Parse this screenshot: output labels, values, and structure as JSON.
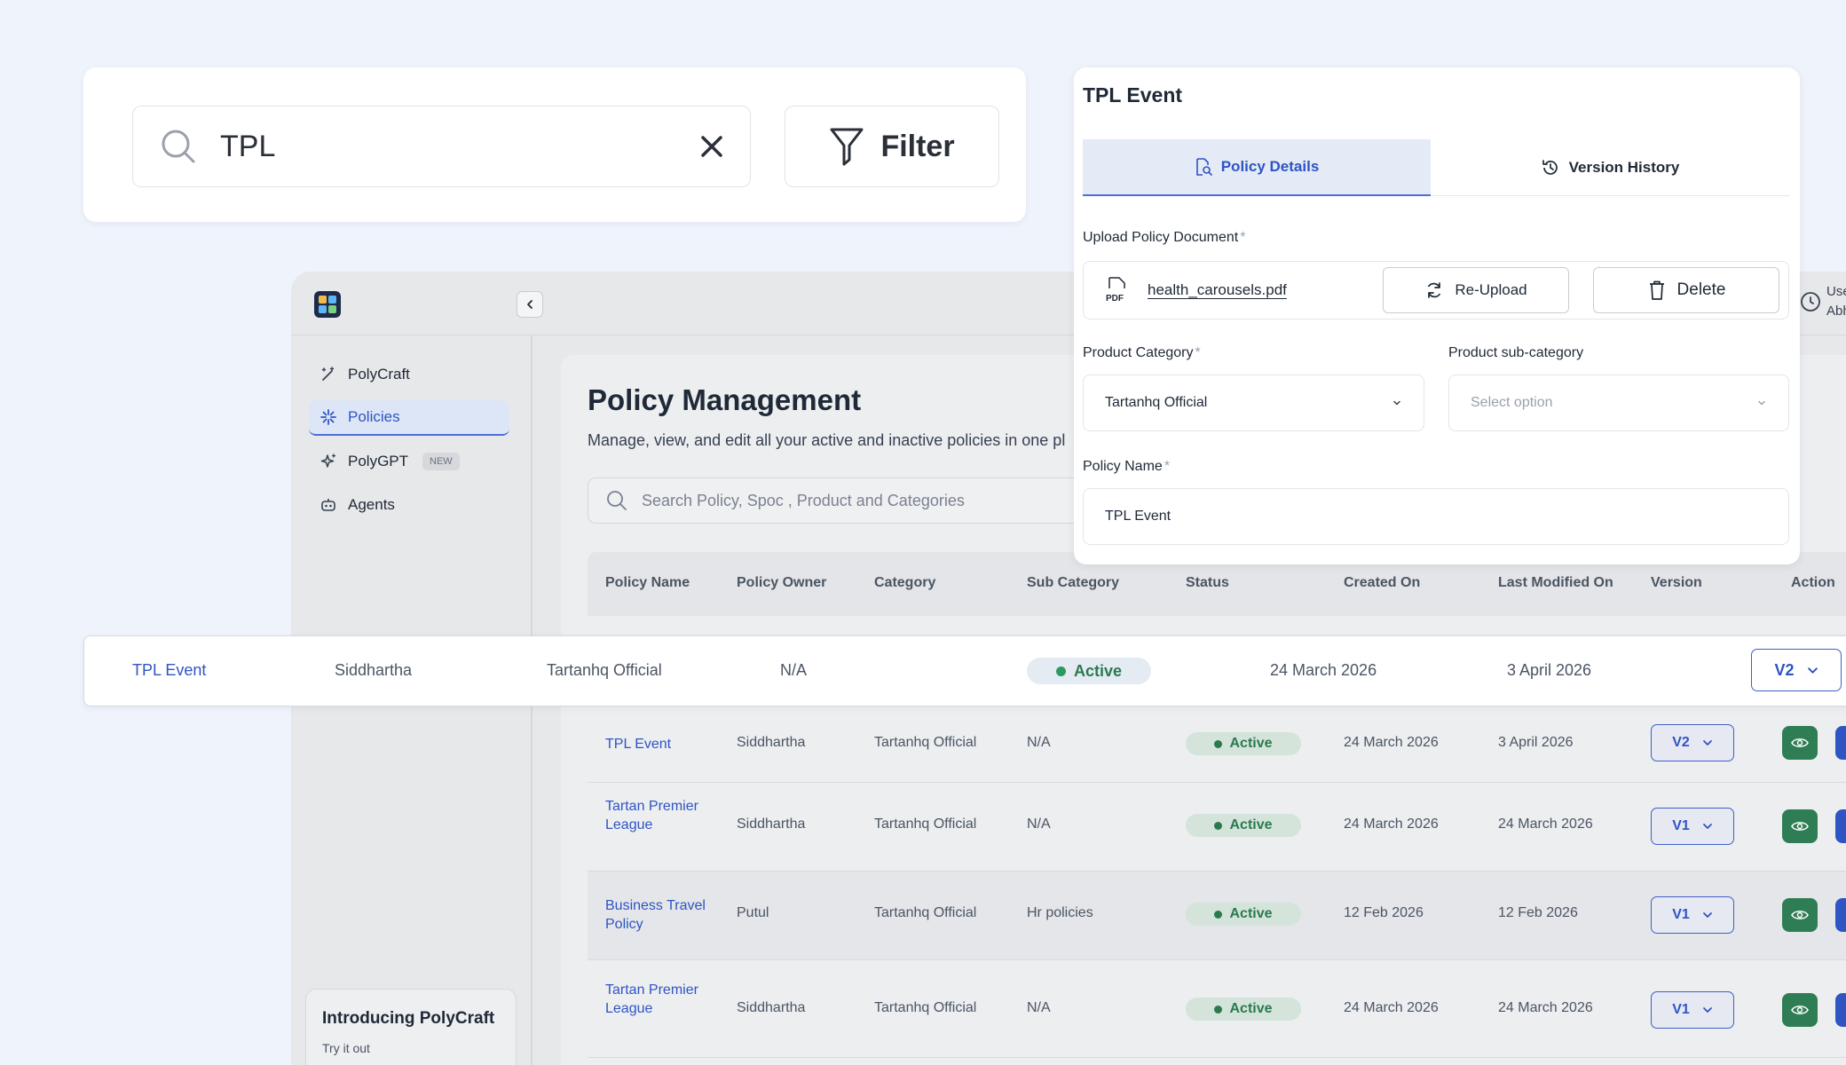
{
  "search": {
    "query": "TPL",
    "filter_label": "Filter"
  },
  "sidebar": {
    "items": [
      {
        "label": "PolyCraft"
      },
      {
        "label": "Policies"
      },
      {
        "label": "PolyGPT",
        "badge": "NEW"
      },
      {
        "label": "Agents"
      }
    ],
    "promo": {
      "title": "Introducing PolyCraft",
      "subtitle": "Try it out"
    }
  },
  "main": {
    "title": "Policy Management",
    "subtitle": "Manage, view, and edit all your active and inactive policies in one pl",
    "search_placeholder": "Search Policy, Spoc , Product and Categories"
  },
  "table": {
    "columns": [
      "Policy Name",
      "Policy Owner",
      "Category",
      "Sub Category",
      "Status",
      "Created On",
      "Last Modified On",
      "Version",
      "Action"
    ],
    "rows": [
      {
        "name": "TPL Event",
        "owner": "Siddhartha",
        "category": "Tartanhq Official",
        "sub": "N/A",
        "status": "Active",
        "created": "24 March 2026",
        "modified": "3 April 2026",
        "version": "V2"
      },
      {
        "name": "Tartan Premier League",
        "owner": "Siddhartha",
        "category": "Tartanhq Official",
        "sub": "N/A",
        "status": "Active",
        "created": "24 March 2026",
        "modified": "24 March 2026",
        "version": "V1"
      },
      {
        "name": "Business Travel Policy",
        "owner": "Putul",
        "category": "Tartanhq Official",
        "sub": "Hr policies",
        "status": "Active",
        "created": "12 Feb 2026",
        "modified": "12 Feb 2026",
        "version": "V1"
      },
      {
        "name": "Tartan Premier League",
        "owner": "Siddhartha",
        "category": "Tartanhq Official",
        "sub": "N/A",
        "status": "Active",
        "created": "24 March 2026",
        "modified": "24 March 2026",
        "version": "V1"
      }
    ]
  },
  "highlight": {
    "name": "TPL Event",
    "owner": "Siddhartha",
    "category": "Tartanhq Official",
    "sub": "N/A",
    "status": "Active",
    "created": "24 March 2026",
    "modified": "3 April 2026",
    "version": "V2"
  },
  "panel": {
    "title": "TPL Event",
    "tabs": [
      "Policy Details",
      "Version History"
    ],
    "upload_label": "Upload Policy Document",
    "required_mark": "*",
    "file_name": "health_carousels.pdf",
    "file_type": "PDF",
    "reupload_label": "Re-Upload",
    "delete_label": "Delete",
    "category_label": "Product Category",
    "category_value": "Tartanhq Official",
    "subcategory_label": "Product sub-category",
    "subcategory_placeholder": "Select option",
    "name_label": "Policy Name",
    "name_value": "TPL Event"
  },
  "peek_text": {
    "line1": "Use",
    "line2": "Abh"
  },
  "colors": {
    "accent": "#2f54c4",
    "success": "#2a7a4e",
    "background": "#eff3fb"
  }
}
